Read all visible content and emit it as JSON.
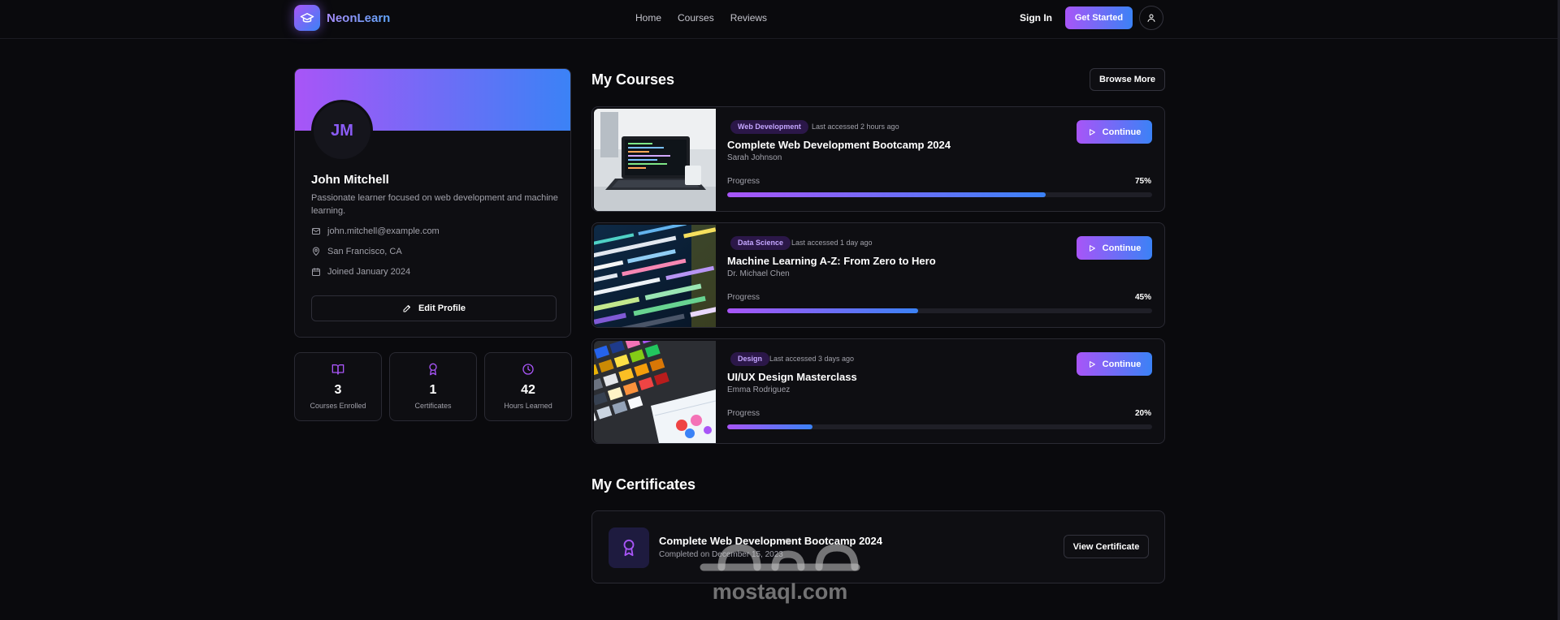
{
  "nav": {
    "brand": "NeonLearn",
    "links": [
      "Home",
      "Courses",
      "Reviews"
    ],
    "sign_in": "Sign In",
    "get_started": "Get Started"
  },
  "profile": {
    "initials": "JM",
    "name": "John Mitchell",
    "bio": "Passionate learner focused on web development and machine learning.",
    "email": "john.mitchell@example.com",
    "location": "San Francisco, CA",
    "joined": "Joined January 2024",
    "edit_label": "Edit Profile"
  },
  "stats": [
    {
      "value": "3",
      "label": "Courses Enrolled",
      "icon": "book-open-icon"
    },
    {
      "value": "1",
      "label": "Certificates",
      "icon": "award-icon"
    },
    {
      "value": "42",
      "label": "Hours Learned",
      "icon": "clock-icon"
    }
  ],
  "courses_section": {
    "title": "My Courses",
    "browse_label": "Browse More",
    "continue_label": "Continue",
    "progress_label": "Progress",
    "items": [
      {
        "category": "Web Development",
        "accessed": "Last accessed 2 hours ago",
        "title": "Complete Web Development Bootcamp 2024",
        "instructor": "Sarah Johnson",
        "progress_text": "75%",
        "progress": 75
      },
      {
        "category": "Data Science",
        "accessed": "Last accessed 1 day ago",
        "title": "Machine Learning A-Z: From Zero to Hero",
        "instructor": "Dr. Michael Chen",
        "progress_text": "45%",
        "progress": 45
      },
      {
        "category": "Design",
        "accessed": "Last accessed 3 days ago",
        "title": "UI/UX Design Masterclass",
        "instructor": "Emma Rodriguez",
        "progress_text": "20%",
        "progress": 20
      }
    ]
  },
  "certificates_section": {
    "title": "My Certificates",
    "items": [
      {
        "title": "Complete Web Development Bootcamp 2024",
        "completed": "Completed on December 15, 2023",
        "view_label": "View Certificate"
      }
    ]
  },
  "watermark": {
    "text": "mostaql.com"
  },
  "colors": {
    "accent_start": "#a855f7",
    "accent_end": "#3b82f6",
    "background": "#0a0a0d",
    "card": "#0e0e12",
    "muted_text": "#a1a1aa"
  }
}
